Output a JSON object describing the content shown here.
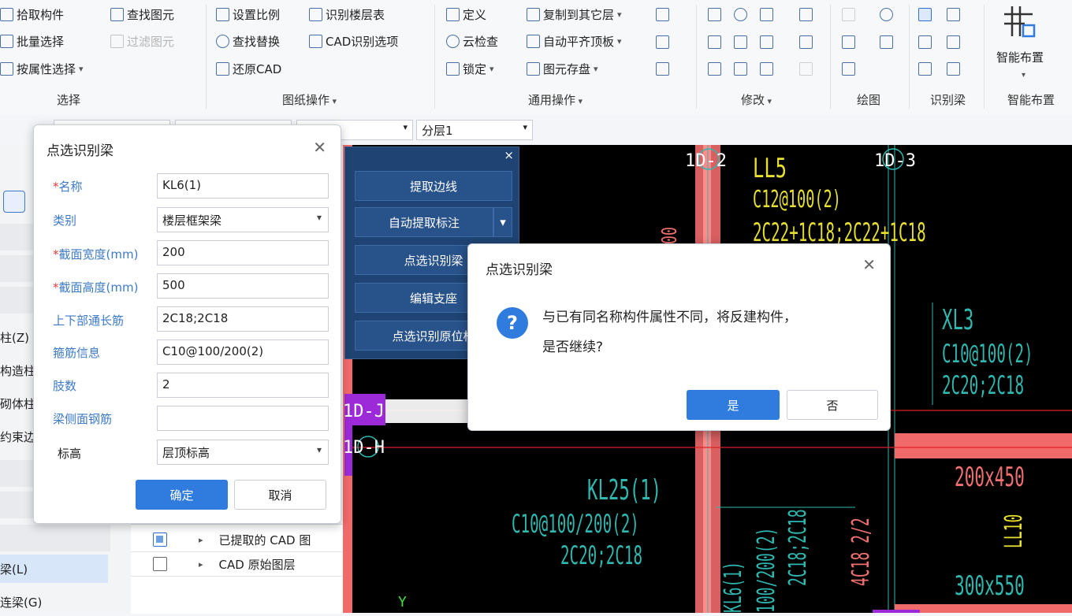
{
  "ribbon": {
    "select_group": {
      "label": "选择",
      "items": [
        "拾取构件",
        "批量选择",
        "按属性选择"
      ],
      "find_element": "查找图元",
      "filter_element": "过滤图元"
    },
    "drawing_ops": {
      "label": "图纸操作",
      "items": [
        "设置比例",
        "识别楼层表",
        "查找替换",
        "CAD识别选项",
        "还原CAD"
      ]
    },
    "common_ops": {
      "label": "通用操作",
      "items": [
        "定义",
        "复制到其它层",
        "云检查",
        "自动平齐顶板",
        "锁定",
        "图元存盘"
      ]
    },
    "modify": {
      "label": "修改"
    },
    "draw": {
      "label": "绘图"
    },
    "identify_beam": {
      "label": "识别梁"
    },
    "smart_layout": {
      "label": "智能布置",
      "button": "智能布置"
    }
  },
  "toolbar2": {
    "layer_select": "分层1"
  },
  "left_panel": {
    "items": [
      "柱(Z)",
      "构造柱",
      "砌体柱",
      "约束边",
      "梁(L)",
      "连梁(G)"
    ]
  },
  "layer_tree": {
    "rows": [
      {
        "label": "已提取的 CAD 图",
        "checked": true
      },
      {
        "label": "CAD 原始图层",
        "checked": false
      }
    ]
  },
  "blue_panel": {
    "close": "×",
    "buttons": [
      "提取边线",
      "自动提取标注",
      "点选识别梁",
      "编辑支座",
      "点选识别原位标"
    ]
  },
  "prop_dialog": {
    "title": "点选识别梁",
    "close": "✕",
    "fields": [
      {
        "label": "名称",
        "required": true,
        "value": "KL6(1)",
        "type": "input"
      },
      {
        "label": "类别",
        "required": false,
        "value": "楼层框架梁",
        "type": "select"
      },
      {
        "label": "截面宽度(mm)",
        "required": true,
        "value": "200",
        "type": "input"
      },
      {
        "label": "截面高度(mm)",
        "required": true,
        "value": "500",
        "type": "input"
      },
      {
        "label": "上下部通长筋",
        "required": false,
        "value": "2C18;2C18",
        "type": "input"
      },
      {
        "label": "箍筋信息",
        "required": false,
        "value": "C10@100/200(2)",
        "type": "input"
      },
      {
        "label": "肢数",
        "required": false,
        "value": "2",
        "type": "input"
      },
      {
        "label": "梁侧面钢筋",
        "required": false,
        "value": "",
        "type": "input"
      },
      {
        "label": "标高",
        "required": false,
        "value": "层顶标高",
        "type": "select"
      }
    ],
    "ok": "确定",
    "cancel": "取消"
  },
  "confirm_dialog": {
    "title": "点选识别梁",
    "close": "✕",
    "icon": "?",
    "message_line1": "与已有同名称构件属性不同，将反建构件，",
    "message_line2": "是否继续?",
    "yes": "是",
    "no": "否"
  },
  "cad": {
    "axis_1": "1D-2",
    "axis_2": "1D-3",
    "axis_j": "1D-J",
    "axis_h": "1D-H",
    "ll5": "LL5",
    "ll5_stirrup": "C12@100(2)",
    "ll5_rebar": "2C22+1C18;2C22+1C18",
    "xl3": "XL3",
    "xl3_stirrup": "C10@100(2)",
    "xl3_rebar": "2C20;2C18",
    "kl25": "KL25(1)",
    "kl25_stirrup": "C10@100/200(2)",
    "kl25_rebar": "2C20;2C18",
    "kl6_vert": "KL6(1)",
    "kl6_vert_stirrup": "100/200(2)",
    "kl6_vert_rebar": "2C18;2C18",
    "v_4c18": "4C18 2/2",
    "dim_200x450": "200x450",
    "ll10": "LL10",
    "dim_300x550": "300x550",
    "axis_y": "Y",
    "v_00": "00"
  }
}
